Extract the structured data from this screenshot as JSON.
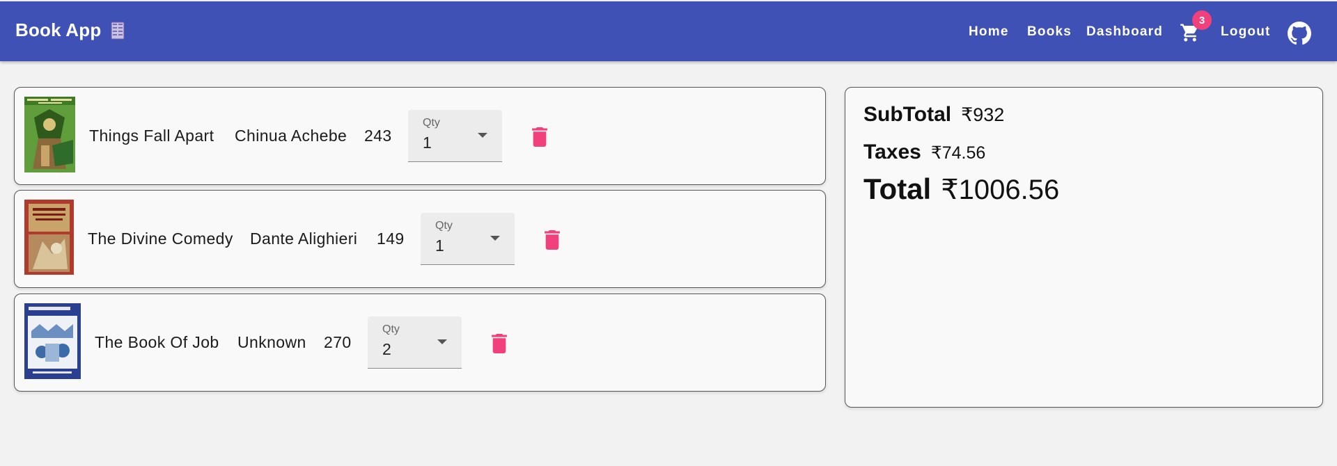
{
  "header": {
    "title": "Book App",
    "nav": {
      "home": "Home",
      "books": "Books",
      "dashboard": "Dashboard",
      "logout": "Logout"
    },
    "cart_count": "3",
    "accent": "#3f51b5",
    "badge_color": "#f0417c"
  },
  "cart": {
    "qty_label": "Qty",
    "items": [
      {
        "title": "Things Fall Apart",
        "author": "Chinua Achebe",
        "price": "243",
        "qty": "1"
      },
      {
        "title": "The Divine Comedy",
        "author": "Dante Alighieri",
        "price": "149",
        "qty": "1"
      },
      {
        "title": "The Book Of Job",
        "author": "Unknown",
        "price": "270",
        "qty": "2"
      }
    ]
  },
  "summary": {
    "subtotal_label": "SubTotal",
    "subtotal_value": "₹932",
    "taxes_label": "Taxes",
    "taxes_value": "₹74.56",
    "total_label": "Total",
    "total_value": "₹1006.56"
  },
  "icons": {
    "brand": "books-icon",
    "cart": "cart-icon",
    "github": "github-icon",
    "delete": "trash-icon",
    "dropdown": "caret-down-icon"
  },
  "delete_color": "#f0417c"
}
